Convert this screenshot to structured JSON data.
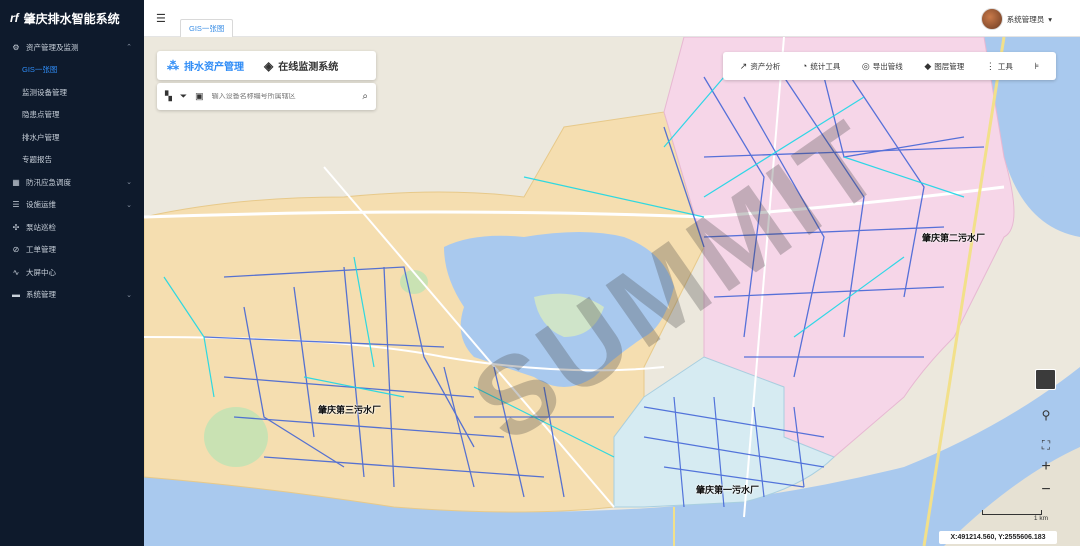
{
  "app": {
    "title": "肇庆排水智能系统",
    "logo": "rf"
  },
  "sidebar": {
    "items": [
      {
        "label": "资产管理及监测",
        "icon": "gear-icon",
        "expanded": true
      },
      {
        "label": "GIS一张图",
        "active": true
      },
      {
        "label": "监测设备管理"
      },
      {
        "label": "隐患点管理"
      },
      {
        "label": "排水户管理"
      },
      {
        "label": "专题报告"
      },
      {
        "label": "防汛应急调度",
        "icon": "grid-icon"
      },
      {
        "label": "设施运维",
        "icon": "list-icon"
      },
      {
        "label": "泵站巡检",
        "icon": "tools-icon"
      },
      {
        "label": "工单管理",
        "icon": "clip-icon"
      },
      {
        "label": "大屏中心",
        "icon": "pulse-icon"
      },
      {
        "label": "系统管理",
        "icon": "monitor-icon"
      }
    ]
  },
  "topbar": {
    "tab_label": "GIS一张图",
    "user_name": "系统管理员"
  },
  "panel": {
    "tab_assets": "排水资产管理",
    "tab_monitor": "在线监测系统",
    "search_placeholder": "输入设备名称编号所属辖区"
  },
  "toolbar": {
    "asset_analysis": "资产分析",
    "stats_tool": "统计工具",
    "export_pipe": "导出管线",
    "layer_mgmt": "图层管理",
    "tools": "工具"
  },
  "map": {
    "watermark": "SUMMIT",
    "plants": [
      "肇庆第二污水厂",
      "肇庆第三污水厂",
      "肇庆第一污水厂"
    ],
    "scale_label": "1 km",
    "coords": "X:491214.560, Y:2555606.183",
    "colors": {
      "zone_west": "#f5deb0",
      "zone_east": "#f6d6e8",
      "zone_south": "#d6ebf2",
      "water": "#a9c9ee",
      "pipe": "#3b5fd6",
      "pipe_cyan": "#19d7e6"
    }
  }
}
